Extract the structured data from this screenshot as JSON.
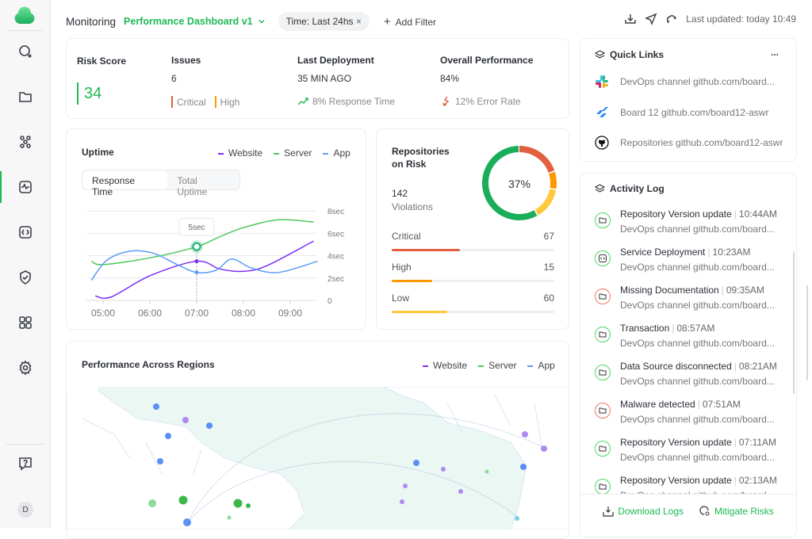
{
  "sidebar": {
    "items": [
      {
        "icon": "search-icon"
      },
      {
        "icon": "folder-icon"
      },
      {
        "icon": "network-icon"
      },
      {
        "icon": "monitoring-icon",
        "active": true
      },
      {
        "icon": "code-icon"
      },
      {
        "icon": "shield-check-icon"
      },
      {
        "icon": "grid-icon"
      },
      {
        "icon": "gear-icon"
      }
    ],
    "help_icon": "help-icon",
    "avatar": "D"
  },
  "header": {
    "crumb": "Monitoring",
    "dashboard": "Performance Dashboard v1",
    "filter_chip": "Time: Last 24hs",
    "add_filter": "Add Filter",
    "last_updated": "Last updated: today 10:49"
  },
  "kpis": {
    "risk_score": {
      "label": "Risk Score",
      "value": "34"
    },
    "issues": {
      "label": "Issues",
      "value": "6",
      "critical": "Critical",
      "high": "High"
    },
    "deployment": {
      "label": "Last Deployment",
      "value": "35 MIN AGO",
      "sub": "8% Response Time"
    },
    "performance": {
      "label": "Overall Performance",
      "value": "84%",
      "sub": "12% Error Rate"
    }
  },
  "colors": {
    "accent": "#1db954",
    "website": "#7b2ff7",
    "server": "#4cc95a",
    "app": "#5b9cf6",
    "critical": "#e2603f",
    "high": "#ff9800",
    "low": "#ffc83d"
  },
  "uptime": {
    "title": "Uptime",
    "tabs": [
      "Response Time",
      "Total  Uptime"
    ],
    "active_tab": "Response Time",
    "tooltip": "5sec"
  },
  "chart_data": {
    "type": "line",
    "title": "Uptime",
    "xlabel": "",
    "ylabel": "",
    "x_ticks": [
      "05:00",
      "06:00",
      "07:00",
      "08:00",
      "09:00"
    ],
    "y_ticks": [
      "0",
      "2sec",
      "4sec",
      "6sec",
      "8sec"
    ],
    "ylim": [
      0,
      8
    ],
    "grid": true,
    "legend": "top-right",
    "series": [
      {
        "name": "Website",
        "color": "#7b2ff7",
        "points": [
          [
            "04:50",
            0.4
          ],
          [
            "05:10",
            0.3
          ],
          [
            "06:00",
            2.2
          ],
          [
            "07:00",
            3.5
          ],
          [
            "07:30",
            2.8
          ],
          [
            "08:00",
            2.6
          ],
          [
            "08:30",
            3.1
          ],
          [
            "09:30",
            5.3
          ]
        ]
      },
      {
        "name": "Server",
        "color": "#4cc95a",
        "points": [
          [
            "04:45",
            3.5
          ],
          [
            "05:00",
            3.2
          ],
          [
            "06:00",
            3.8
          ],
          [
            "07:00",
            4.8
          ],
          [
            "07:30",
            5.7
          ],
          [
            "08:00",
            6.5
          ],
          [
            "08:45",
            7.2
          ],
          [
            "09:30",
            7.0
          ]
        ]
      },
      {
        "name": "App",
        "color": "#5b9cf6",
        "points": [
          [
            "04:45",
            1.8
          ],
          [
            "05:05",
            3.6
          ],
          [
            "05:35",
            4.4
          ],
          [
            "06:05",
            4.2
          ],
          [
            "06:35",
            3.2
          ],
          [
            "07:00",
            2.5
          ],
          [
            "07:25",
            2.7
          ],
          [
            "07:45",
            3.7
          ],
          [
            "08:10",
            2.9
          ],
          [
            "08:45",
            2.5
          ],
          [
            "09:35",
            3.5
          ]
        ]
      }
    ]
  },
  "repos": {
    "title_line1": "Repositories",
    "title_line2": "on Risk",
    "count": "142",
    "count_label": "Violations",
    "donut_label": "37%",
    "donut_segments": [
      {
        "color": "#e2603f",
        "pct": 20
      },
      {
        "color": "#ff9800",
        "pct": 8
      },
      {
        "color": "#ffc83d",
        "pct": 14
      },
      {
        "color": "#1aad5a",
        "pct": 58
      }
    ],
    "rows": [
      {
        "label": "Critical",
        "value": "67",
        "fill": 0.42,
        "color": "#e2603f"
      },
      {
        "label": "High",
        "value": "15",
        "fill": 0.25,
        "color": "#ff9800"
      },
      {
        "label": "Low",
        "value": "60",
        "fill": 0.34,
        "color": "#ffc83d"
      }
    ]
  },
  "regions": {
    "title": "Performance Across Regions",
    "legend": [
      "Website",
      "Server",
      "App"
    ]
  },
  "quick_links": {
    "title": "Quick Links",
    "more": "...",
    "items": [
      {
        "icon": "slack-icon",
        "text": "DevOps channel github.com/board..."
      },
      {
        "icon": "jira-icon",
        "text": "Board 12 github.com/board12-aswr"
      },
      {
        "icon": "github-icon",
        "text": "Repositories github.com/board12-aswr"
      }
    ]
  },
  "activity": {
    "title": "Activity Log",
    "items": [
      {
        "title": "Repository Version update",
        "time": "10:44AM",
        "sub": "DevOps channel github.com/board...",
        "status": "green",
        "icon": "folder-icon"
      },
      {
        "title": "Service Deployment",
        "time": "10:23AM",
        "sub": "DevOps channel github.com/board...",
        "status": "green",
        "icon": "code-icon"
      },
      {
        "title": "Missing Documentation",
        "time": "09:35AM",
        "sub": "DevOps channel github.com/board...",
        "status": "red",
        "icon": "folder-icon"
      },
      {
        "title": "Transaction",
        "time": "08:57AM",
        "sub": "DevOps channel github.com/board...",
        "status": "green",
        "icon": "folder-icon"
      },
      {
        "title": "Data Source disconnected",
        "time": "08:21AM",
        "sub": "DevOps channel github.com/board...",
        "status": "green",
        "icon": "folder-icon"
      },
      {
        "title": "Malware detected",
        "time": "07:51AM",
        "sub": "DevOps channel github.com/board...",
        "status": "red",
        "icon": "folder-icon"
      },
      {
        "title": "Repository Version update",
        "time": "07:11AM",
        "sub": "DevOps channel github.com/board...",
        "status": "green",
        "icon": "folder-icon"
      },
      {
        "title": "Repository Version update",
        "time": "02:13AM",
        "sub": "DevOps channel github.com/board...",
        "status": "green",
        "icon": "folder-icon"
      }
    ],
    "download": "Download Logs",
    "mitigate": "Mitigate Risks"
  }
}
